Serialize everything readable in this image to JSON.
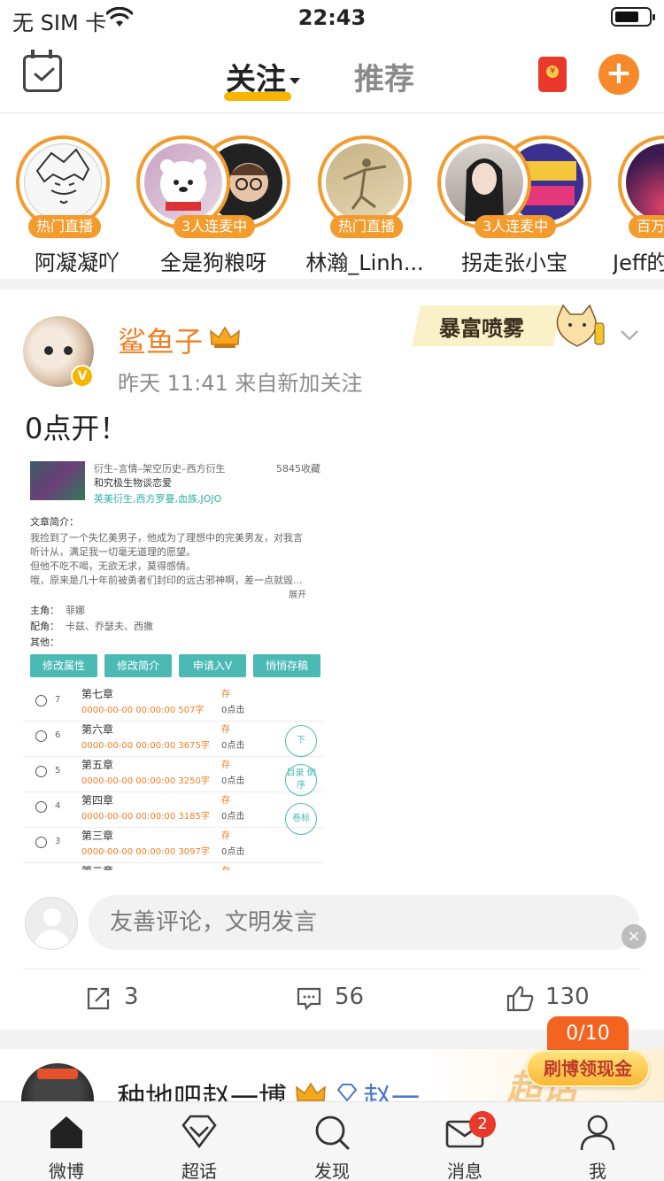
{
  "status_bar": {
    "carrier": "无 SIM 卡",
    "time": "22:43"
  },
  "header": {
    "tab_follow": "关注",
    "tab_recommend": "推荐",
    "accent_color": "#f7892a",
    "underline_color": "#f7b500"
  },
  "live_items": [
    {
      "name": "阿凝凝吖",
      "badge": "热门直播"
    },
    {
      "name": "全是狗粮呀",
      "badge": "3人连麦中"
    },
    {
      "name": "林瀚_Linh...",
      "badge": "热门直播"
    },
    {
      "name": "拐走张小宝",
      "badge": "3人连麦中"
    },
    {
      "name": "Jeff的",
      "badge": "百万"
    }
  ],
  "post": {
    "author": "鲨鱼子",
    "meta": "昨天 11:41  来自新加关注",
    "sticker": "暴富喷雾",
    "text": "0点开！",
    "image": {
      "category": "衍生–言情–架空历史–西方衍生",
      "favorites": "5845收藏",
      "book_title": "和究极生物谈恋爱",
      "tags": "英美衍生,西方罗曼,血族,JOJO",
      "intro_label": "文章简介：",
      "intro_lines": [
        "我捡到了一个失忆美男子，他成为了理想中的完美男友，对我言",
        "听计从，满足我一切毫无道理的愿望。",
        "但他不吃不喝，无欲无求，莫得感情。",
        "哦，原来是几十年前被勇者们封印的远古邪神啊，差一点就毁..."
      ],
      "expand": "展开",
      "protagonist_label": "主角：",
      "protagonist": "菲娜",
      "supporting_label": "配角：",
      "supporting": "卡兹、乔瑟夫、西撒",
      "other_label": "其他：",
      "buttons": [
        "修改属性",
        "修改简介",
        "申请入V",
        "悄悄存稿"
      ],
      "chapters": [
        {
          "num": "7",
          "title": "第七章",
          "date": "0000-00-00 00:00:00 507字",
          "state": "存",
          "clicks": "0点击"
        },
        {
          "num": "6",
          "title": "第六章",
          "date": "0000-00-00 00:00:00 3675字",
          "state": "存",
          "clicks": "0点击"
        },
        {
          "num": "5",
          "title": "第五章",
          "date": "0000-00-00 00:00:00 3250字",
          "state": "存",
          "clicks": "0点击"
        },
        {
          "num": "4",
          "title": "第四章",
          "date": "0000-00-00 00:00:00 3185字",
          "state": "存",
          "clicks": "0点击"
        },
        {
          "num": "3",
          "title": "第三章",
          "date": "0000-00-00 00:00:00 3097字",
          "state": "存",
          "clicks": "0点击"
        },
        {
          "num": "",
          "title": "第二章",
          "date": "",
          "state": "存",
          "clicks": ""
        }
      ],
      "side_buttons": [
        "下",
        "目录 倒序",
        "卷标"
      ]
    },
    "comment_placeholder": "友善评论，文明发言",
    "reposts": "3",
    "comments": "56",
    "likes": "130"
  },
  "next_post": {
    "author": "种地吧赵一博",
    "tag": "赵一",
    "bg_text": "超话"
  },
  "reward": {
    "counter": "0/10",
    "button": "刷博领现金"
  },
  "tabbar": {
    "items": [
      {
        "label": "微博"
      },
      {
        "label": "超话"
      },
      {
        "label": "发现"
      },
      {
        "label": "消息",
        "badge": "2"
      },
      {
        "label": "我"
      }
    ]
  }
}
